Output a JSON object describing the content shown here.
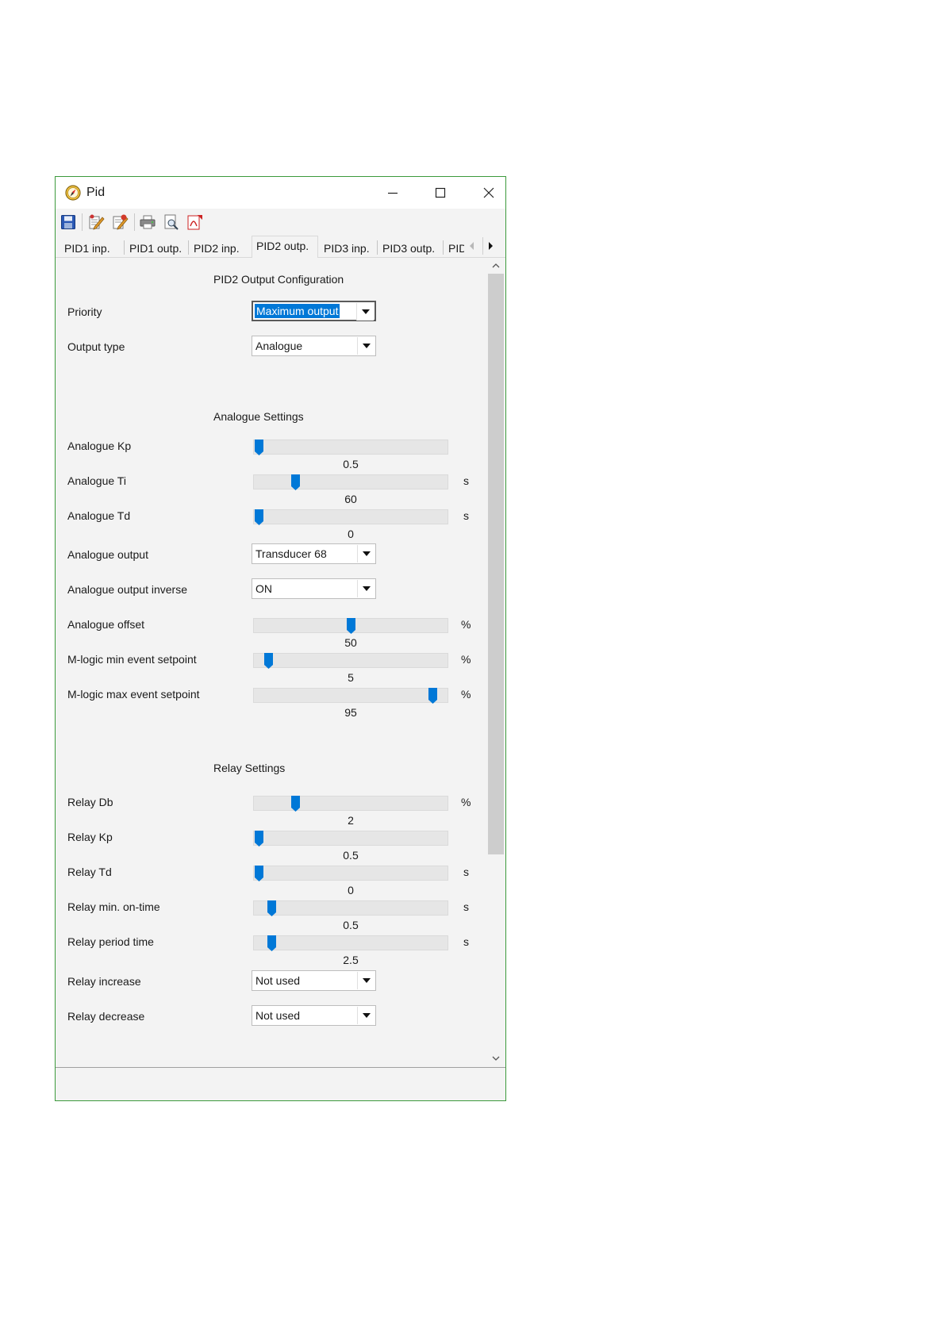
{
  "window": {
    "title": "Pid",
    "icon": "compass-icon"
  },
  "toolbar": {
    "icons": [
      "save-icon",
      "write-icon",
      "read-icon",
      "print-icon",
      "print-preview-icon",
      "pdf-export-icon"
    ]
  },
  "tabs": [
    {
      "label": "PID1 inp.",
      "active": false
    },
    {
      "label": "PID1 outp.",
      "active": false
    },
    {
      "label": "PID2 inp.",
      "active": false
    },
    {
      "label": "PID2 outp.",
      "active": true
    },
    {
      "label": "PID3 inp.",
      "active": false
    },
    {
      "label": "PID3 outp.",
      "active": false
    },
    {
      "label": "PID",
      "active": false
    }
  ],
  "sections": {
    "output_config": "PID2 Output Configuration",
    "analogue": "Analogue Settings",
    "relay": "Relay Settings"
  },
  "fields": {
    "priority": {
      "label": "Priority",
      "value": "Maximum output"
    },
    "output_type": {
      "label": "Output type",
      "value": "Analogue"
    },
    "analogue_kp": {
      "label": "Analogue Kp",
      "value": "0.5",
      "unit": "",
      "fraction": 0.0
    },
    "analogue_ti": {
      "label": "Analogue Ti",
      "value": "60",
      "unit": "s",
      "fraction": 0.2
    },
    "analogue_td": {
      "label": "Analogue Td",
      "value": "0",
      "unit": "s",
      "fraction": 0.0
    },
    "analogue_output": {
      "label": "Analogue output",
      "value": "Transducer 68"
    },
    "analogue_output_inverse": {
      "label": "Analogue output inverse",
      "value": "ON"
    },
    "analogue_offset": {
      "label": "Analogue offset",
      "value": "50",
      "unit": "%",
      "fraction": 0.5
    },
    "mlogic_min": {
      "label": "M-logic min event setpoint",
      "value": "5",
      "unit": "%",
      "fraction": 0.05
    },
    "mlogic_max": {
      "label": "M-logic max event setpoint",
      "value": "95",
      "unit": "%",
      "fraction": 0.95
    },
    "relay_db": {
      "label": "Relay Db",
      "value": "2",
      "unit": "%",
      "fraction": 0.2
    },
    "relay_kp": {
      "label": "Relay Kp",
      "value": "0.5",
      "unit": "",
      "fraction": 0.0
    },
    "relay_td": {
      "label": "Relay Td",
      "value": "0",
      "unit": "s",
      "fraction": 0.0
    },
    "relay_min_on": {
      "label": "Relay min. on-time",
      "value": "0.5",
      "unit": "s",
      "fraction": 0.07
    },
    "relay_period": {
      "label": "Relay period time",
      "value": "2.5",
      "unit": "s",
      "fraction": 0.07
    },
    "relay_increase": {
      "label": "Relay increase",
      "value": "Not used"
    },
    "relay_decrease": {
      "label": "Relay decrease",
      "value": "Not used"
    }
  },
  "colors": {
    "window_border": "#3c9a3c",
    "accent": "#0078d7",
    "panel": "#f3f3f3"
  }
}
